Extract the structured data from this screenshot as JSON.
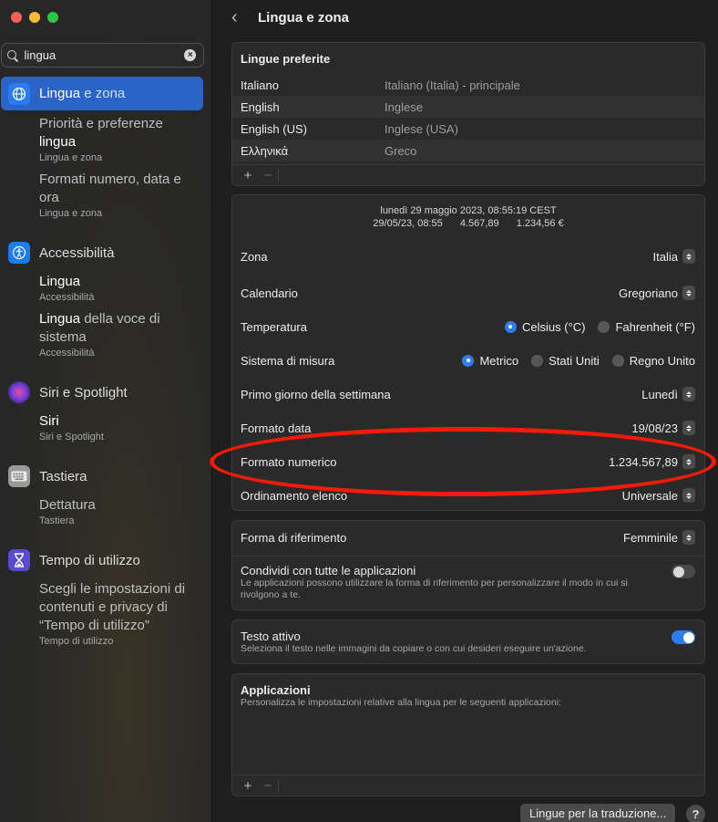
{
  "sidebar": {
    "search": {
      "value": "lingua",
      "clear_icon": "clear-icon"
    },
    "items": [
      {
        "label_hl": "Lingua",
        "label_rest": " e zona",
        "icon": "globe-icon",
        "color": "#2b7bf2"
      },
      {
        "label_hl": "",
        "label_rest": "Accessibilità",
        "icon": "accessibility-icon",
        "color": "#1e7cf2"
      },
      {
        "label_hl": "",
        "label_rest": "Siri e Spotlight",
        "icon": "siri-icon",
        "color": "#6b3fd0"
      },
      {
        "label_hl": "",
        "label_rest": "Tastiera",
        "icon": "keyboard-icon",
        "color": "#8a8a8a"
      },
      {
        "label_hl": "",
        "label_rest": "Tempo di utilizzo",
        "icon": "hourglass-icon",
        "color": "#5a4bd6"
      }
    ],
    "subs": [
      {
        "title_pre": "Priorità e preferenze",
        "title_hl": "lingua",
        "caption": "Lingua e zona"
      },
      {
        "title_pre": "Formati numero, data e ora",
        "title_hl": "",
        "caption": "Lingua e zona"
      },
      {
        "title_pre": "",
        "title_hl": "Lingua",
        "caption": "Accessibilità"
      },
      {
        "title_pre": "",
        "title_hl": "Lingua",
        "title_post": " della voce di sistema",
        "caption": "Accessibilità"
      },
      {
        "title_pre": "",
        "title_hl": "Siri",
        "caption": "Siri e Spotlight"
      },
      {
        "title_pre": "Dettatura",
        "title_hl": "",
        "caption": "Tastiera"
      },
      {
        "title_pre": "Scegli le impostazioni di contenuti e privacy di “Tempo di utilizzo”",
        "title_hl": "",
        "caption": "Tempo di utilizzo"
      }
    ]
  },
  "header": {
    "title": "Lingua e zona",
    "back_icon": "chevron-left-icon"
  },
  "preferred": {
    "title": "Lingue preferite",
    "rows": [
      {
        "lang": "Italiano",
        "desc": "Italiano (Italia) - principale"
      },
      {
        "lang": "English",
        "desc": "Inglese"
      },
      {
        "lang": "English (US)",
        "desc": "Inglese (USA)"
      },
      {
        "lang": "Ελληνικά",
        "desc": "Greco"
      }
    ],
    "add": "+",
    "remove": "−"
  },
  "region": {
    "preview_line1": "lunedì 29 maggio 2023, 08:55:19 CEST",
    "preview_date": "29/05/23, 08:55",
    "preview_num": "4.567,89",
    "preview_cur": "1.234,56 €",
    "zona": {
      "label": "Zona",
      "value": "Italia"
    },
    "calendario": {
      "label": "Calendario",
      "value": "Gregoriano"
    },
    "temperatura": {
      "label": "Temperatura",
      "opt1": "Celsius (°C)",
      "opt2": "Fahrenheit (°F)"
    },
    "misura": {
      "label": "Sistema di misura",
      "opt1": "Metrico",
      "opt2": "Stati Uniti",
      "opt3": "Regno Unito"
    },
    "primo_giorno": {
      "label": "Primo giorno della settimana",
      "value": "Lunedì"
    },
    "formato_data": {
      "label": "Formato data",
      "value": "19/08/23"
    },
    "formato_numerico": {
      "label": "Formato numerico",
      "value": "1.234.567,89"
    },
    "ordinamento": {
      "label": "Ordinamento elenco",
      "value": "Universale"
    }
  },
  "riferimento": {
    "label": "Forma di riferimento",
    "value": "Femminile",
    "share_title": "Condividi con tutte le applicazioni",
    "share_desc": "Le applicazioni possono utilizzare la forma di riferimento per personalizzare il modo in cui si rivolgono a te."
  },
  "testo_attivo": {
    "title": "Testo attivo",
    "desc": "Seleziona il testo nelle immagini da copiare o con cui desideri eseguire un'azione."
  },
  "applicazioni": {
    "title": "Applicazioni",
    "desc": "Personalizza le impostazioni relative alla lingua per le seguenti applicazioni:",
    "add": "+",
    "remove": "−"
  },
  "footer": {
    "translate_button": "Lingue per la traduzione...",
    "help": "?"
  },
  "colors": {
    "accent": "#2f7cf6",
    "annotation": "#f21b0a",
    "selection": "#2c63c7"
  }
}
